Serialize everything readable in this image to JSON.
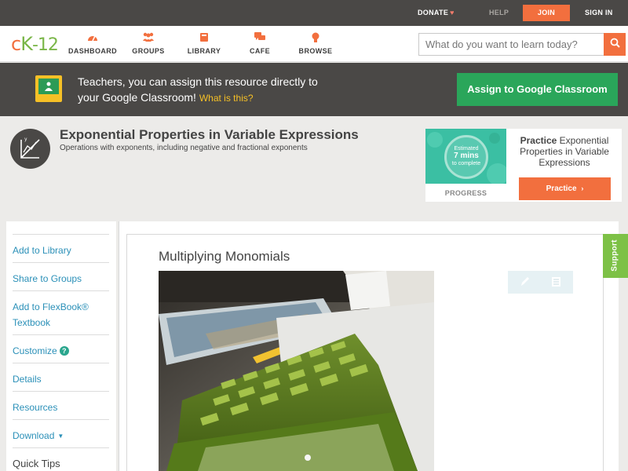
{
  "topbar": {
    "donate": "DONATE",
    "help": "HELP",
    "join": "JOIN",
    "signin": "SIGN IN"
  },
  "logo": {
    "c": "c",
    "k": "K",
    "dash": "-12"
  },
  "nav": {
    "items": [
      {
        "label": "DASHBOARD",
        "icon": "gauge-icon"
      },
      {
        "label": "GROUPS",
        "icon": "people-icon"
      },
      {
        "label": "LIBRARY",
        "icon": "book-icon"
      },
      {
        "label": "CAFE",
        "icon": "chat-icon"
      },
      {
        "label": "BROWSE",
        "icon": "lightbulb-icon"
      }
    ],
    "search_placeholder": "What do you want to learn today?"
  },
  "banner": {
    "line1": "Teachers, you can assign this resource directly to",
    "line2": "your Google Classroom!",
    "what_link": "What is this?",
    "assign_label": "Assign to Google Classroom"
  },
  "concept": {
    "title": "Exponential Properties in Variable Expressions",
    "subtitle": "Operations with exponents, including negative and fractional exponents"
  },
  "practice": {
    "estimated": "Estimated",
    "minutes": "7 mins",
    "to_complete": "to complete",
    "progress_label": "PROGRESS",
    "bold": "Practice",
    "text": "Exponential Properties in Variable Expressions",
    "button": "Practice",
    "progress_fraction": 0
  },
  "sidebar": {
    "items": [
      "Add to Library",
      "Share to Groups",
      "Add to FlexBook®",
      "Textbook",
      "Customize",
      "Details",
      "Resources",
      "Download",
      "Quick Tips"
    ]
  },
  "content": {
    "section_title": "Multiplying Monomials",
    "support": "Support"
  },
  "colors": {
    "accent": "#f26f3e",
    "green": "#7ab648",
    "classroom_green": "#2aa65a",
    "link_blue": "#2b90b8",
    "dark_bar": "#4a4846"
  }
}
